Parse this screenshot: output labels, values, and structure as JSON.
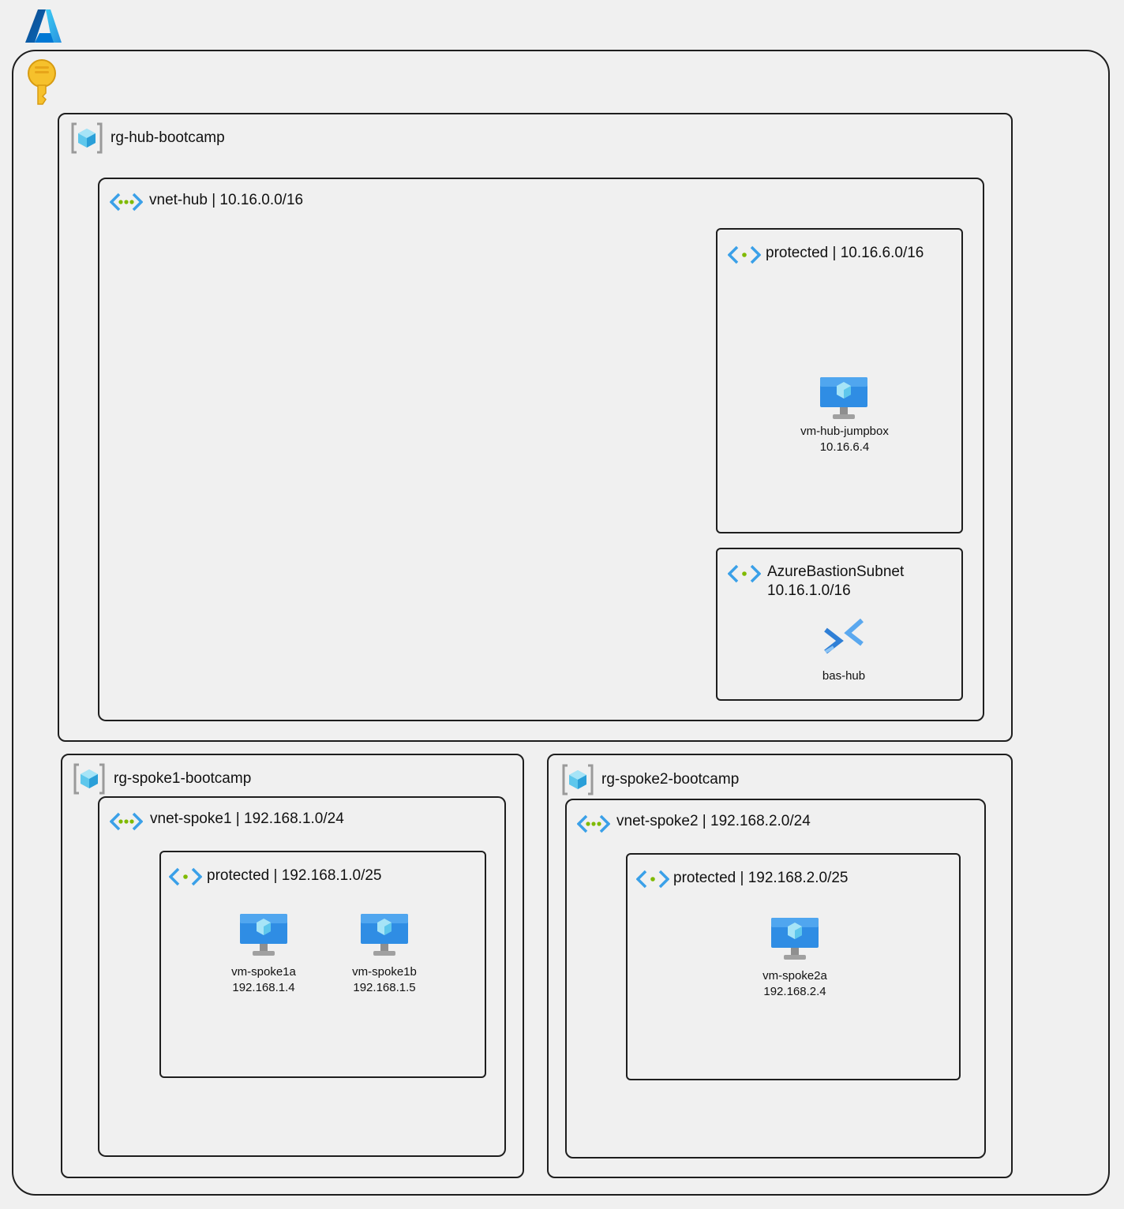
{
  "hub": {
    "rg_label": "rg-hub-bootcamp",
    "vnet_label": "vnet-hub | 10.16.0.0/16",
    "protected_label": "protected | 10.16.6.0/16",
    "jumpbox_name": "vm-hub-jumpbox",
    "jumpbox_ip": "10.16.6.4",
    "bastion_subnet_name": "AzureBastionSubnet",
    "bastion_subnet_cidr": "10.16.1.0/16",
    "bastion_name": "bas-hub"
  },
  "spoke1": {
    "rg_label": "rg-spoke1-bootcamp",
    "vnet_label": "vnet-spoke1 | 192.168.1.0/24",
    "protected_label": "protected | 192.168.1.0/25",
    "vms": [
      {
        "name": "vm-spoke1a",
        "ip": "192.168.1.4"
      },
      {
        "name": "vm-spoke1b",
        "ip": "192.168.1.5"
      }
    ]
  },
  "spoke2": {
    "rg_label": "rg-spoke2-bootcamp",
    "vnet_label": "vnet-spoke2 | 192.168.2.0/24",
    "protected_label": "protected | 192.168.2.0/25",
    "vms": [
      {
        "name": "vm-spoke2a",
        "ip": "192.168.2.4"
      }
    ]
  }
}
